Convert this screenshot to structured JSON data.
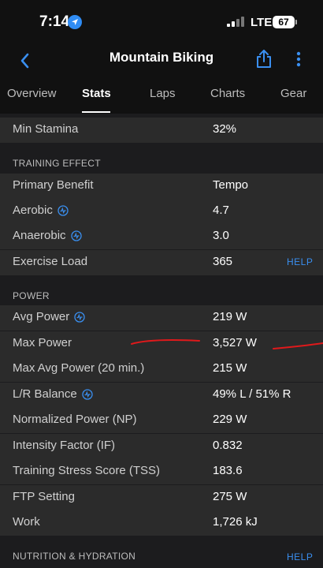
{
  "status_bar": {
    "time": "7:14",
    "network": "LTE",
    "battery": "67"
  },
  "header": {
    "title": "Mountain Biking"
  },
  "tabs": [
    {
      "label": "Overview",
      "active": false
    },
    {
      "label": "Stats",
      "active": true
    },
    {
      "label": "Laps",
      "active": false
    },
    {
      "label": "Charts",
      "active": false
    },
    {
      "label": "Gear",
      "active": false
    }
  ],
  "top_row": {
    "label": "Min Stamina",
    "value": "32%"
  },
  "training_effect": {
    "title": "TRAINING EFFECT",
    "rows": [
      {
        "label": "Primary Benefit",
        "value": "Tempo"
      },
      {
        "label": "Aerobic",
        "value": "4.7",
        "icon": "activity-info-icon"
      },
      {
        "label": "Anaerobic",
        "value": "3.0",
        "icon": "activity-info-icon"
      },
      {
        "label": "Exercise Load",
        "value": "365",
        "help": "HELP"
      }
    ]
  },
  "power": {
    "title": "POWER",
    "rows": [
      {
        "label": "Avg Power",
        "value": "219 W",
        "icon": "activity-info-icon"
      },
      {
        "label": "Max Power",
        "value": "3,527 W"
      },
      {
        "label": "Max Avg Power (20 min.)",
        "value": "215 W"
      },
      {
        "label": "L/R Balance",
        "value": "49% L / 51% R",
        "icon": "activity-info-icon"
      },
      {
        "label": "Normalized Power (NP)",
        "value": "229 W"
      },
      {
        "label": "Intensity Factor (IF)",
        "value": "0.832"
      },
      {
        "label": "Training Stress Score (TSS)",
        "value": "183.6"
      },
      {
        "label": "FTP Setting",
        "value": "275 W"
      },
      {
        "label": "Work",
        "value": "1,726 kJ"
      }
    ]
  },
  "nutrition": {
    "title": "NUTRITION & HYDRATION",
    "help": "HELP"
  },
  "colors": {
    "accent": "#3a8ff0",
    "annotation": "#e0191b",
    "row_bg": "#2b2b2b",
    "section_bg": "#1c1c1e"
  }
}
